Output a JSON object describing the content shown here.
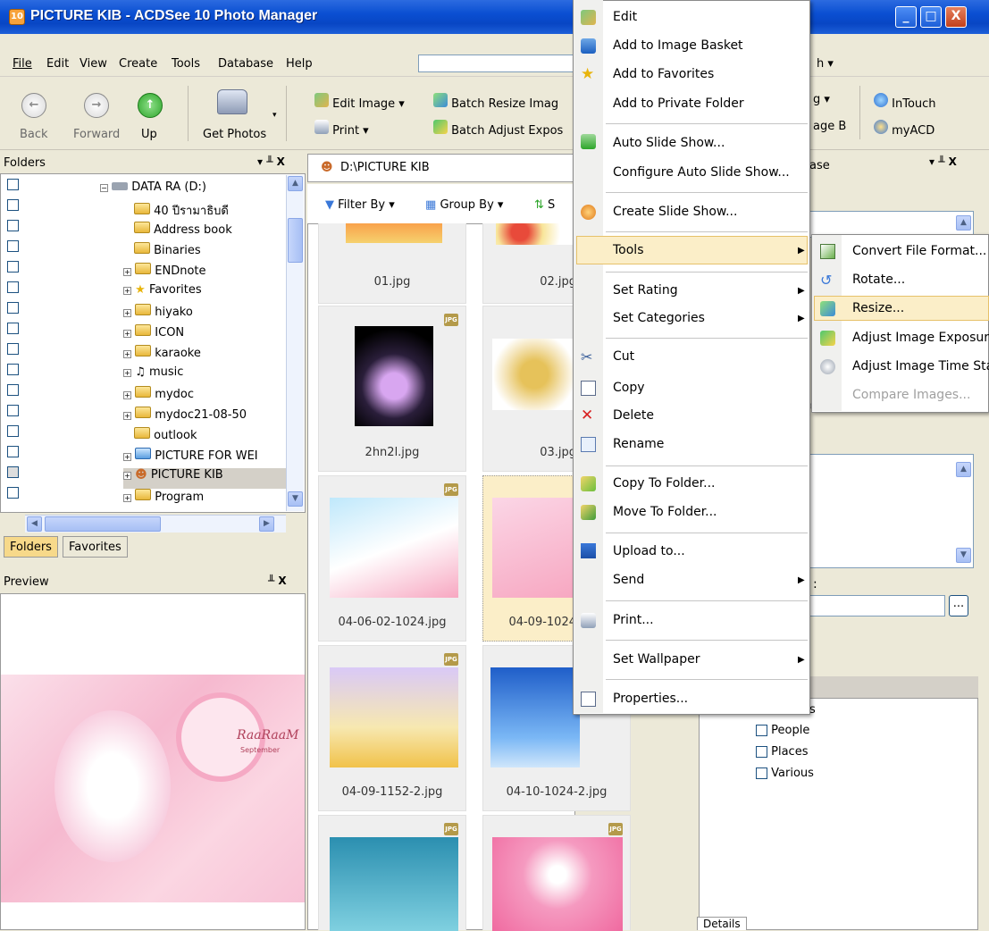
{
  "window": {
    "title": "PICTURE KIB - ACDSee 10 Photo Manager",
    "icon_label": "10",
    "controls": [
      "_",
      "□",
      "X"
    ]
  },
  "menubar": {
    "items": [
      "File",
      "Edit",
      "View",
      "Create",
      "Tools",
      "Database",
      "Help"
    ],
    "right_label": "h ▾"
  },
  "toolbar": {
    "back": "Back",
    "forward": "Forward",
    "up": "Up",
    "get_photos": "Get Photos",
    "edit_image": "Edit Image ▾",
    "print": "Print ▾",
    "batch_resize": "Batch Resize Imag",
    "batch_adjust": "Batch Adjust Expos",
    "right_g": "g ▾",
    "right_age": "age B",
    "intouch": "InTouch",
    "myacd": "myACD"
  },
  "folders_pane": {
    "title": "Folders",
    "header_controls": "▾ ╨ X",
    "root": "DATA RA (D:)",
    "items": [
      {
        "label": "40 ปีรามาธิบดี",
        "expand": false
      },
      {
        "label": "Address book",
        "expand": false
      },
      {
        "label": "Binaries",
        "expand": false
      },
      {
        "label": "ENDnote",
        "expand": true
      },
      {
        "label": "Favorites",
        "expand": true
      },
      {
        "label": "hiyako",
        "expand": true
      },
      {
        "label": "ICON",
        "expand": true
      },
      {
        "label": "karaoke",
        "expand": true
      },
      {
        "label": "music",
        "expand": true
      },
      {
        "label": "mydoc",
        "expand": true
      },
      {
        "label": "mydoc21-08-50",
        "expand": true
      },
      {
        "label": "outlook",
        "expand": false
      },
      {
        "label": "PICTURE FOR WEI",
        "expand": true
      },
      {
        "label": "PICTURE KIB",
        "expand": true
      },
      {
        "label": "Program",
        "expand": true
      }
    ],
    "tabs": [
      "Folders",
      "Favorites"
    ]
  },
  "preview_pane": {
    "title": "Preview",
    "header_controls": "╨ X",
    "image_text": "RaaRaaM",
    "image_subtext": "September"
  },
  "browser": {
    "path": "D:\\PICTURE KIB",
    "filter_by": "Filter By ▾",
    "group_by": "Group By ▾",
    "sort": "S",
    "thumbnails": [
      {
        "name": "01.jpg",
        "badge": ""
      },
      {
        "name": "02.jpg",
        "badge": ""
      },
      {
        "name": "2hn2l.jpg",
        "badge": "JPG"
      },
      {
        "name": "03.jpg",
        "badge": ""
      },
      {
        "name": "04-06-02-1024.jpg",
        "badge": "JPG"
      },
      {
        "name": "04-09-1024",
        "badge": "JPG"
      },
      {
        "name": "04-09-1152-2.jpg",
        "badge": "JPG"
      },
      {
        "name": "04-10-1024-2.jpg",
        "badge": "JPG"
      },
      {
        "name": "",
        "badge": "JPG"
      },
      {
        "name": "",
        "badge": "JPG"
      }
    ]
  },
  "context_menu": {
    "items": [
      {
        "label": "Edit",
        "u": "",
        "arrow": false
      },
      {
        "label": "Add to Image Basket",
        "arrow": false
      },
      {
        "label": "Add to Favorites",
        "arrow": false
      },
      {
        "label": "Add to Private Folder",
        "arrow": false
      },
      {
        "label": "Auto Slide Show...",
        "arrow": false
      },
      {
        "label": "Configure Auto Slide Show...",
        "arrow": false
      },
      {
        "label": "Create Slide Show...",
        "arrow": false
      },
      {
        "label": "Tools",
        "arrow": true
      },
      {
        "label": "Set Rating",
        "arrow": true
      },
      {
        "label": "Set Categories",
        "arrow": true
      },
      {
        "label": "Cut",
        "arrow": false
      },
      {
        "label": "Copy",
        "arrow": false
      },
      {
        "label": "Delete",
        "arrow": false
      },
      {
        "label": "Rename",
        "arrow": false
      },
      {
        "label": "Copy To Folder...",
        "arrow": false
      },
      {
        "label": "Move To Folder...",
        "arrow": false
      },
      {
        "label": "Upload to...",
        "arrow": false
      },
      {
        "label": "Send",
        "arrow": true
      },
      {
        "label": "Print...",
        "arrow": false
      },
      {
        "label": "Set Wallpaper",
        "arrow": true
      },
      {
        "label": "Properties...",
        "arrow": false
      }
    ]
  },
  "tools_submenu": {
    "items": [
      "Convert File Format...",
      "Rotate...",
      "Resize...",
      "Adjust Image Exposure",
      "Adjust Image Time Sta",
      "Compare Images..."
    ]
  },
  "right_pane": {
    "title_fragment": "ase",
    "header_controls": "▾ ╨ X",
    "field_fragment": ":",
    "browse": "...",
    "categories_fragment": "s",
    "categories": [
      "People",
      "Places",
      "Various"
    ],
    "bottom_tab": "Details"
  }
}
